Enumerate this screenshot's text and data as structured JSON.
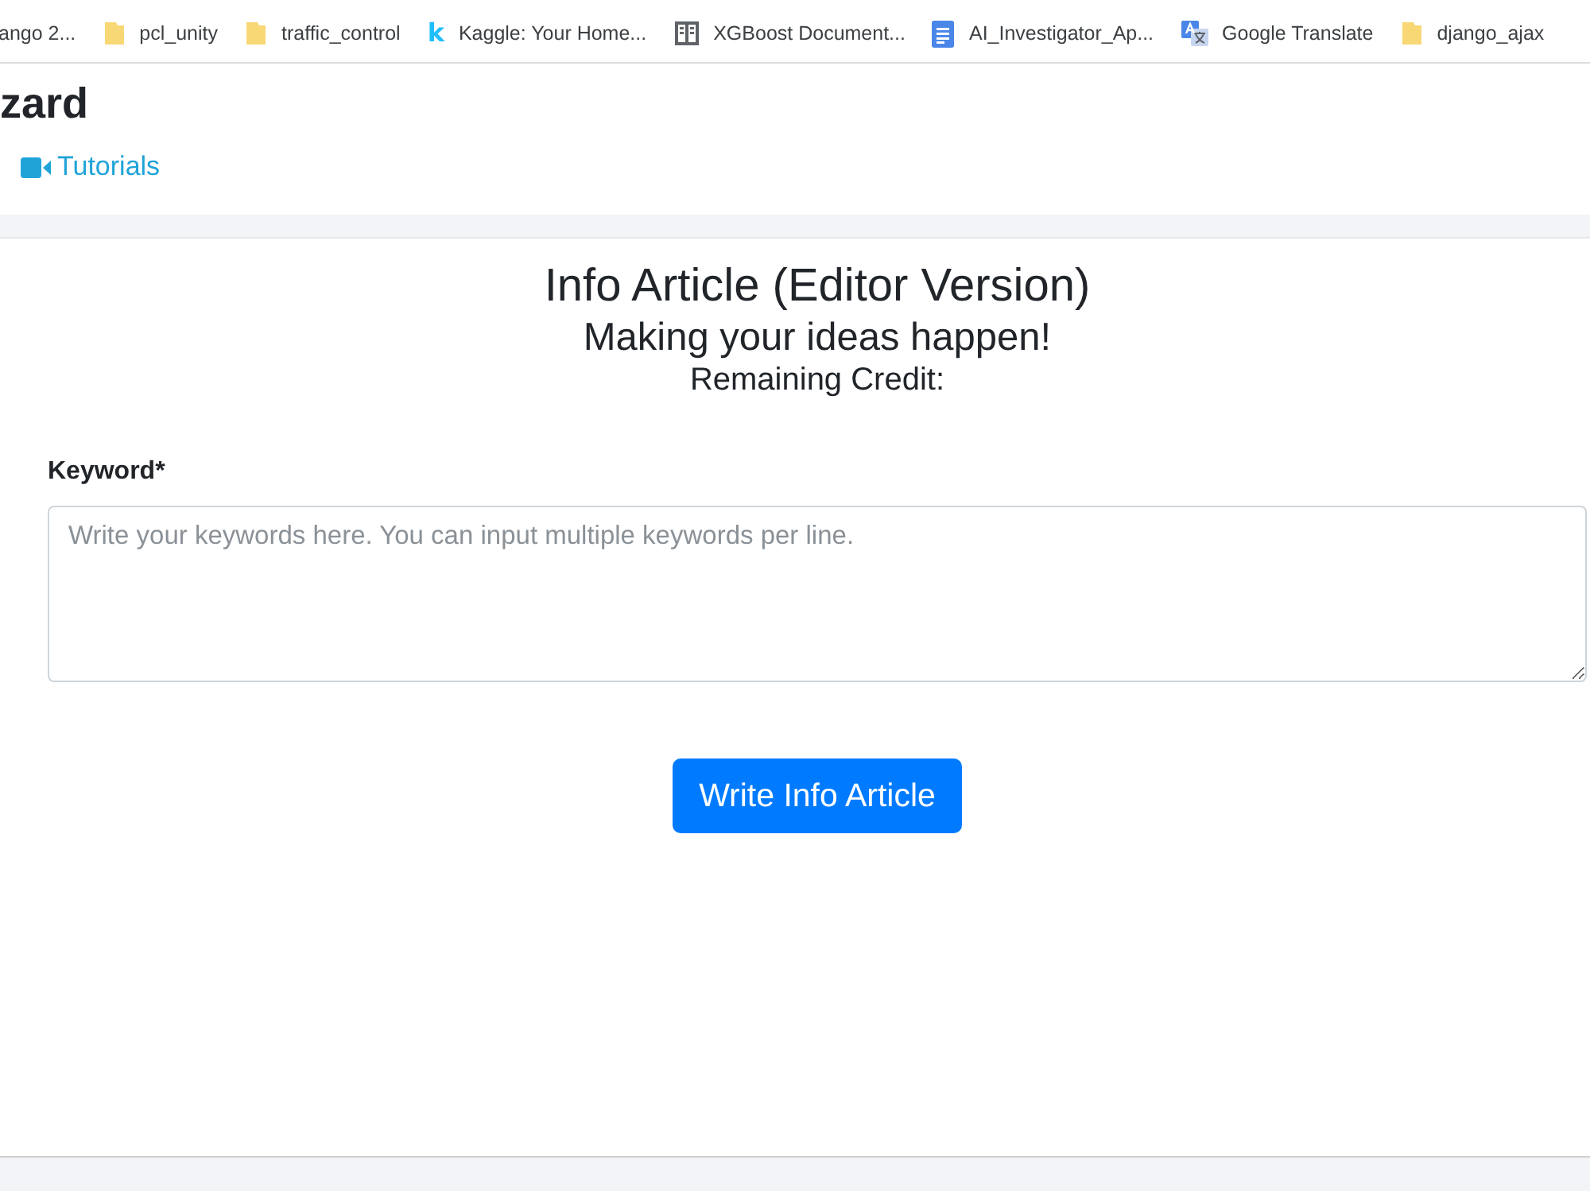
{
  "browser": {
    "bookmarks": [
      {
        "kind": "none",
        "label": "ango 2..."
      },
      {
        "kind": "folder",
        "label": "pcl_unity"
      },
      {
        "kind": "folder",
        "label": "traffic_control"
      },
      {
        "kind": "letter",
        "glyph": "k",
        "label": "Kaggle: Your Home..."
      },
      {
        "kind": "book",
        "label": "XGBoost Document..."
      },
      {
        "kind": "doc",
        "label": "AI_Investigator_Ap..."
      },
      {
        "kind": "translate",
        "label": "Google Translate"
      },
      {
        "kind": "folder",
        "label": "django_ajax"
      }
    ]
  },
  "header": {
    "title": "zard",
    "links": [
      {
        "label": "Tutorials"
      }
    ]
  },
  "card": {
    "title": "Info Article (Editor Version)",
    "subtitle": "Making your ideas happen!",
    "credit_label": "Remaining Credit:",
    "field": {
      "label": "Keyword*",
      "placeholder": "Write your keywords here. You can input multiple keywords per line."
    },
    "button": "Write Info Article"
  }
}
